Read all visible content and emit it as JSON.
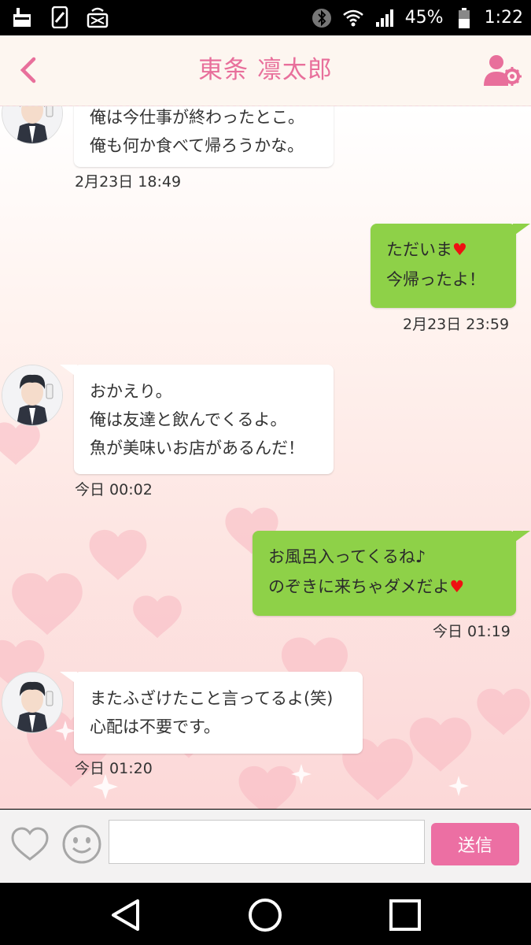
{
  "status_bar": {
    "battery_percent": "45%",
    "time": "1:22",
    "icons": [
      "cleaner-icon",
      "sim-icon",
      "cast-icon",
      "bluetooth-icon",
      "wifi-icon",
      "signal-icon",
      "battery-icon"
    ]
  },
  "header": {
    "title": "東条 凛太郎",
    "back_icon": "chevron-left-icon",
    "settings_icon": "profile-settings-icon",
    "accent_color": "#e86f9b"
  },
  "messages": [
    {
      "from": "contact",
      "lines": [
        "俺は今仕事が終わったとこ。",
        "俺も何か食べて帰ろうかな。"
      ],
      "time": "2月23日 18:49"
    },
    {
      "from": "me",
      "lines": [
        "ただいま",
        "今帰ったよ！"
      ],
      "heart_after_line": 0,
      "time": "2月23日 23:59"
    },
    {
      "from": "contact",
      "lines": [
        "おかえり。",
        "俺は友達と飲んでくるよ。",
        "魚が美味いお店があるんだ！"
      ],
      "time": "今日 00:02"
    },
    {
      "from": "me",
      "lines": [
        "お風呂入ってくるね♪",
        "のぞきに来ちゃダメだよ"
      ],
      "heart_after_line": 1,
      "time": "今日 01:19"
    },
    {
      "from": "contact",
      "lines": [
        "またふざけたこと言ってるよ(笑)",
        "心配は不要です。"
      ],
      "time": "今日 01:20"
    }
  ],
  "input_bar": {
    "like_icon": "heart-outline-icon",
    "emoji_icon": "smiley-icon",
    "message_value": "",
    "send_label": "送信",
    "send_color": "#ec6fa3"
  },
  "nav_bar": {
    "icons": [
      "back-triangle-icon",
      "home-circle-icon",
      "recents-square-icon"
    ]
  },
  "colors": {
    "outgoing_bubble": "#8ed148",
    "incoming_bubble": "#ffffff",
    "heart": "#ee1111"
  }
}
